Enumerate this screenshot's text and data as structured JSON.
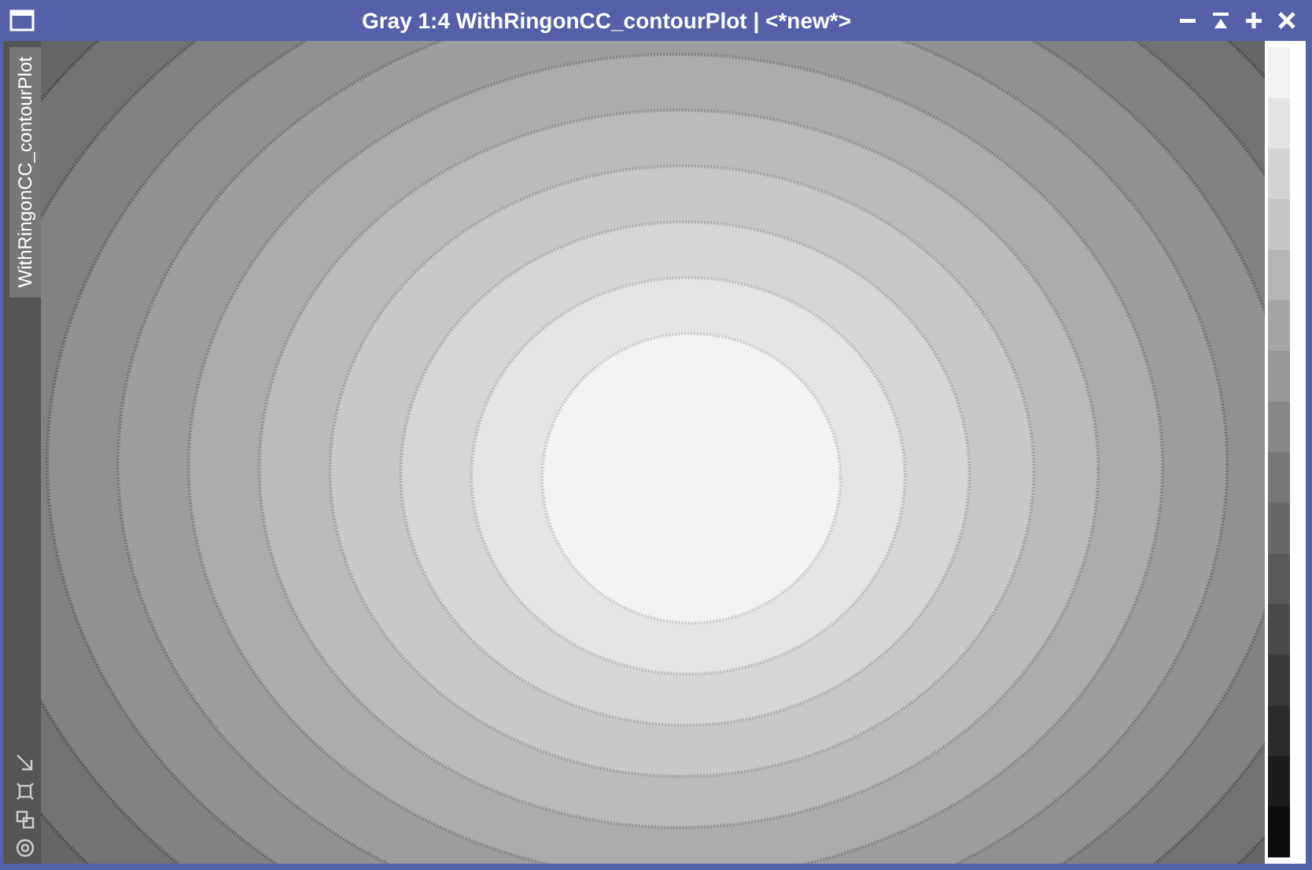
{
  "window": {
    "title": "Gray 1:4 WithRingonCC_contourPlot | <*new*>"
  },
  "side_tab": {
    "label": "WithRingonCC_contourPlot",
    "selected": true
  }
}
